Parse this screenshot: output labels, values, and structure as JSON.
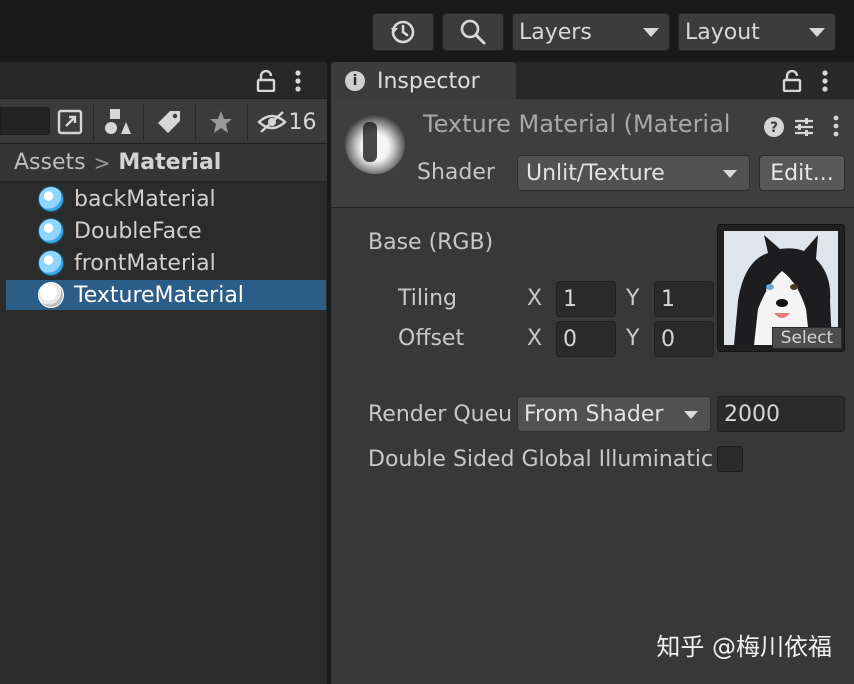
{
  "toolbar": {
    "history_icon": "history-icon",
    "search_icon": "search-icon",
    "layers_label": "Layers",
    "layout_label": "Layout"
  },
  "project": {
    "hidden_count": "16",
    "breadcrumb": [
      "Assets",
      "Material"
    ],
    "assets": [
      {
        "label": "backMaterial",
        "selected": false
      },
      {
        "label": "DoubleFace",
        "selected": false
      },
      {
        "label": "frontMaterial",
        "selected": false
      },
      {
        "label": "TextureMaterial",
        "selected": true
      }
    ]
  },
  "inspector": {
    "tab_label": "Inspector",
    "material_title": "Texture Material (Material",
    "shader_label": "Shader",
    "shader_value": "Unlit/Texture",
    "edit_label": "Edit...",
    "base_label": "Base (RGB)",
    "tiling_label": "Tiling",
    "offset_label": "Offset",
    "x_label": "X",
    "y_label": "Y",
    "tiling_x": "1",
    "tiling_y": "1",
    "offset_x": "0",
    "offset_y": "0",
    "select_label": "Select",
    "render_queue_label": "Render Queu",
    "render_queue_mode": "From Shader",
    "render_queue_value": "2000",
    "double_sided_label": "Double Sided Global Illuminatic",
    "double_sided_checked": false
  },
  "watermark": "知乎 @梅川依福",
  "colors": {
    "selection": "#2c5d87",
    "material_icon": "#8fd6ff"
  }
}
